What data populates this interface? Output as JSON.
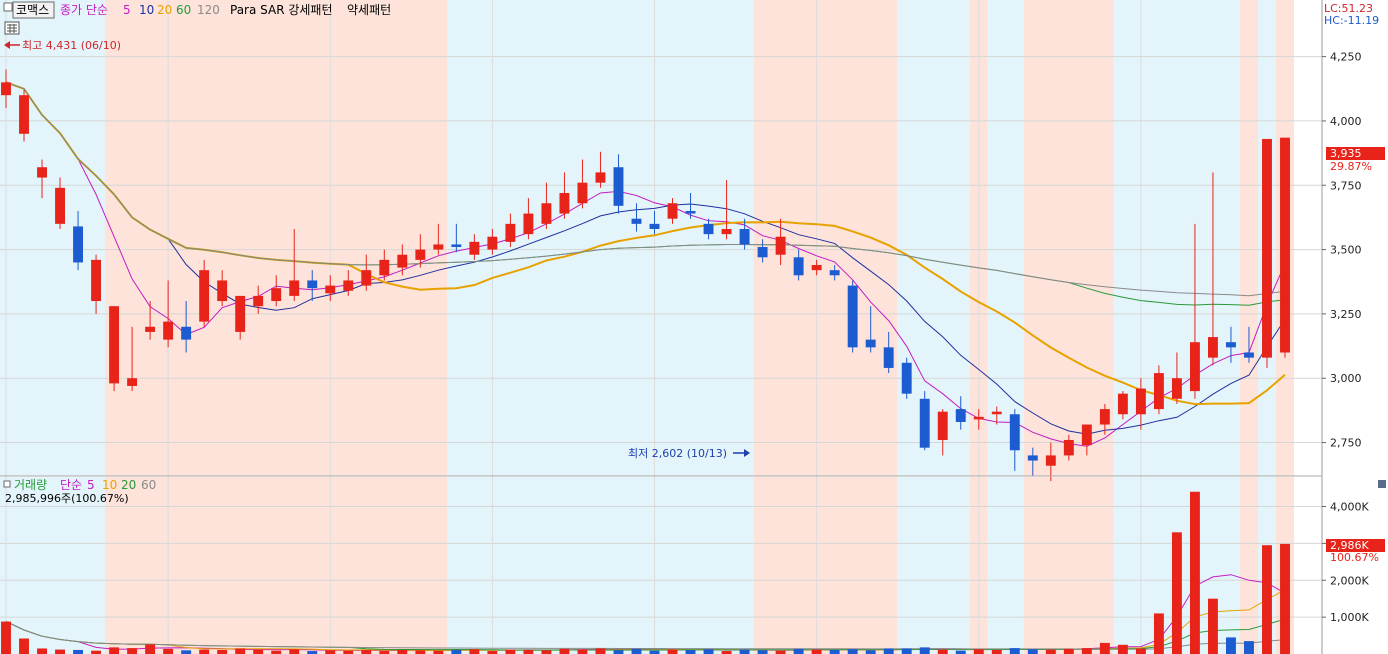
{
  "header": {
    "stock_name": "코맥스",
    "price_label": "종가 단순",
    "ma_periods": [
      "5",
      "10",
      "20",
      "60",
      "120"
    ],
    "indicator_label": "Para SAR 강세패턴",
    "weak_label": "약세패턴",
    "lc": "LC:51.23",
    "hc": "HC:-11.19"
  },
  "volume_header": {
    "title": "거래량",
    "ma_label": "단순",
    "ma_periods": [
      "5",
      "10",
      "20",
      "60"
    ],
    "value_text": "2,985,996주(100.67%)"
  },
  "annotations": {
    "high": "최고 4,431 (06/10)",
    "low": "최저 2,602 (10/13)"
  },
  "price_axis": {
    "ticks": [
      "4,250",
      "4,000",
      "3,750",
      "3,500",
      "3,250",
      "3,000",
      "2,750"
    ],
    "current": "3,935",
    "current_pct": "29.87%"
  },
  "volume_axis": {
    "ticks": [
      "4,000K",
      "3,000K",
      "2,000K",
      "1,000K"
    ],
    "current": "2,986K",
    "current_pct": "100.67%"
  },
  "colors": {
    "up": "#e8231a",
    "down": "#1d5bd0",
    "bull_zone": "#fde3da",
    "bear_zone": "#e3f5fb",
    "ma5": "#c51cc5",
    "ma10": "#1f2f9f",
    "ma20": "#e8a200",
    "ma60": "#2a9a3a",
    "ma120": "#8a8a8a"
  },
  "chart_data": {
    "type": "candlestick",
    "price_range": [
      2620,
      4470
    ],
    "volume_range": [
      0,
      4800
    ],
    "volume_unit": "K",
    "sar_zones": [
      {
        "from": 0,
        "to": 5,
        "trend": "bear"
      },
      {
        "from": 6,
        "to": 24,
        "trend": "bull"
      },
      {
        "from": 25,
        "to": 41,
        "trend": "bear"
      },
      {
        "from": 42,
        "to": 49,
        "trend": "bull"
      },
      {
        "from": 50,
        "to": 53,
        "trend": "bear"
      },
      {
        "from": 54,
        "to": 54,
        "trend": "bull"
      },
      {
        "from": 55,
        "to": 56,
        "trend": "bear"
      },
      {
        "from": 57,
        "to": 61,
        "trend": "bull"
      },
      {
        "from": 62,
        "to": 68,
        "trend": "bear"
      },
      {
        "from": 69,
        "to": 69,
        "trend": "bull"
      },
      {
        "from": 70,
        "to": 70,
        "trend": "bear"
      },
      {
        "from": 71,
        "to": 71,
        "trend": "bull"
      }
    ],
    "candles": [
      [
        4100,
        4200,
        4050,
        4150
      ],
      [
        3950,
        4120,
        3920,
        4100
      ],
      [
        3780,
        3850,
        3700,
        3820
      ],
      [
        3600,
        3780,
        3580,
        3740
      ],
      [
        3590,
        3650,
        3420,
        3450
      ],
      [
        3300,
        3480,
        3250,
        3460
      ],
      [
        2980,
        3280,
        2950,
        3280
      ],
      [
        2970,
        3200,
        2950,
        3000
      ],
      [
        3180,
        3300,
        3150,
        3200
      ],
      [
        3150,
        3380,
        3120,
        3220
      ],
      [
        3200,
        3300,
        3100,
        3150
      ],
      [
        3220,
        3460,
        3200,
        3420
      ],
      [
        3300,
        3420,
        3280,
        3380
      ],
      [
        3180,
        3300,
        3150,
        3320
      ],
      [
        3280,
        3360,
        3250,
        3320
      ],
      [
        3300,
        3400,
        3280,
        3350
      ],
      [
        3320,
        3580,
        3300,
        3380
      ],
      [
        3380,
        3420,
        3300,
        3350
      ],
      [
        3330,
        3400,
        3300,
        3360
      ],
      [
        3340,
        3420,
        3320,
        3380
      ],
      [
        3360,
        3480,
        3340,
        3420
      ],
      [
        3400,
        3500,
        3380,
        3460
      ],
      [
        3430,
        3520,
        3400,
        3480
      ],
      [
        3460,
        3560,
        3430,
        3500
      ],
      [
        3500,
        3600,
        3480,
        3520
      ],
      [
        3520,
        3600,
        3490,
        3510
      ],
      [
        3480,
        3560,
        3460,
        3530
      ],
      [
        3500,
        3580,
        3480,
        3550
      ],
      [
        3530,
        3640,
        3510,
        3600
      ],
      [
        3560,
        3700,
        3540,
        3640
      ],
      [
        3600,
        3760,
        3580,
        3680
      ],
      [
        3640,
        3800,
        3620,
        3720
      ],
      [
        3680,
        3850,
        3660,
        3760
      ],
      [
        3760,
        3880,
        3740,
        3800
      ],
      [
        3820,
        3870,
        3640,
        3670
      ],
      [
        3620,
        3680,
        3570,
        3600
      ],
      [
        3600,
        3650,
        3560,
        3580
      ],
      [
        3620,
        3700,
        3600,
        3680
      ],
      [
        3650,
        3720,
        3620,
        3640
      ],
      [
        3600,
        3620,
        3540,
        3560
      ],
      [
        3560,
        3770,
        3540,
        3580
      ],
      [
        3580,
        3620,
        3500,
        3520
      ],
      [
        3510,
        3540,
        3450,
        3470
      ],
      [
        3480,
        3620,
        3440,
        3550
      ],
      [
        3470,
        3500,
        3380,
        3400
      ],
      [
        3420,
        3460,
        3400,
        3440
      ],
      [
        3420,
        3440,
        3380,
        3400
      ],
      [
        3360,
        3380,
        3100,
        3120
      ],
      [
        3150,
        3280,
        3100,
        3120
      ],
      [
        3120,
        3180,
        3020,
        3040
      ],
      [
        3060,
        3080,
        2920,
        2940
      ],
      [
        2920,
        2950,
        2720,
        2730
      ],
      [
        2760,
        2880,
        2700,
        2870
      ],
      [
        2880,
        2930,
        2800,
        2830
      ],
      [
        2840,
        2880,
        2800,
        2850
      ],
      [
        2860,
        2890,
        2820,
        2870
      ],
      [
        2860,
        2880,
        2640,
        2720
      ],
      [
        2700,
        2730,
        2620,
        2680
      ],
      [
        2660,
        2750,
        2600,
        2700
      ],
      [
        2700,
        2780,
        2680,
        2760
      ],
      [
        2740,
        2800,
        2700,
        2820
      ],
      [
        2820,
        2900,
        2780,
        2880
      ],
      [
        2860,
        2950,
        2840,
        2940
      ],
      [
        2860,
        3000,
        2800,
        2960
      ],
      [
        2880,
        3050,
        2860,
        3020
      ],
      [
        2920,
        3100,
        2900,
        3000
      ],
      [
        2950,
        3600,
        2920,
        3140
      ],
      [
        3080,
        3800,
        3050,
        3160
      ],
      [
        3140,
        3200,
        3060,
        3120
      ],
      [
        3100,
        3200,
        3060,
        3080
      ],
      [
        3080,
        3700,
        3040,
        3930
      ],
      [
        3100,
        3930,
        3080,
        3935
      ]
    ],
    "volumes": [
      880,
      420,
      150,
      120,
      110,
      90,
      180,
      160,
      260,
      140,
      100,
      120,
      110,
      150,
      120,
      90,
      130,
      80,
      100,
      90,
      110,
      80,
      110,
      100,
      90,
      110,
      130,
      80,
      120,
      110,
      100,
      140,
      120,
      150,
      100,
      140,
      90,
      120,
      110,
      130,
      80,
      120,
      100,
      90,
      140,
      120,
      110,
      130,
      100,
      150,
      150,
      180,
      120,
      90,
      130,
      110,
      160,
      130,
      120,
      140,
      160,
      300,
      250,
      150,
      1100,
      3300,
      4400,
      1500,
      450,
      350,
      2950,
      2986
    ]
  }
}
